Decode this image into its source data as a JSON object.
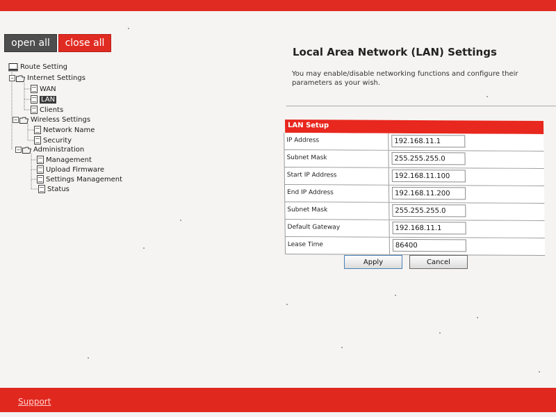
{
  "toolbar": {
    "open_all": "open all",
    "close_all": "close all"
  },
  "tree": {
    "root": "Route Setting",
    "internet_settings": "Internet Settings",
    "wan": "WAN",
    "lan": "LAN",
    "clients": "Clients",
    "wireless_settings": "Wireless Settings",
    "network_name": "Network Name",
    "security": "Security",
    "administration": "Administration",
    "management": "Management",
    "upload_firmware": "Upload Firmware",
    "settings_management": "Settings Management",
    "status": "Status"
  },
  "main": {
    "title": "Local Area Network (LAN) Settings",
    "description": "You may enable/disable networking functions and configure their parameters as your wish."
  },
  "lan_setup": {
    "header": "LAN Setup",
    "rows": [
      {
        "label": "IP Address",
        "value": "192.168.11.1"
      },
      {
        "label": "Subnet Mask",
        "value": "255.255.255.0"
      },
      {
        "label": "Start IP Address",
        "value": "192.168.11.100"
      },
      {
        "label": "End IP Address",
        "value": "192.168.11.200"
      },
      {
        "label": "Subnet Mask",
        "value": "255.255.255.0"
      },
      {
        "label": "Default Gateway",
        "value": "192.168.11.1"
      },
      {
        "label": "Lease Time",
        "value": "86400"
      }
    ]
  },
  "actions": {
    "apply": "Apply",
    "cancel": "Cancel"
  },
  "footer": {
    "support": "Support"
  },
  "colors": {
    "brand_red": "#e02b22",
    "dark_button": "#4e4e4e"
  },
  "icons": {
    "computer": "computer-icon",
    "folder": "folder-icon",
    "page": "page-icon",
    "expander_minus": "minus-box-icon"
  }
}
